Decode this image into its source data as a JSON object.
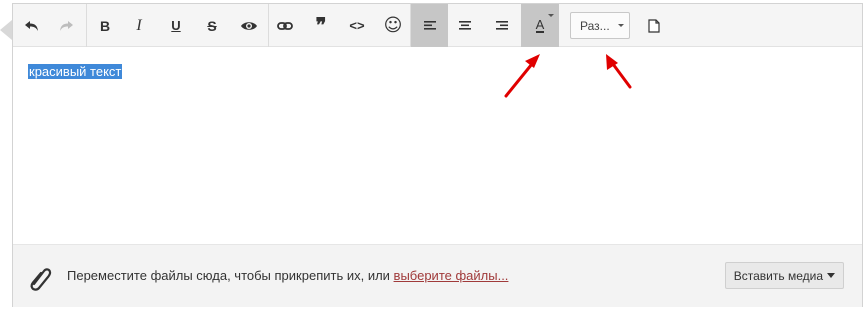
{
  "toolbar": {
    "buttons": [
      {
        "name": "undo-icon",
        "title": "undo"
      },
      {
        "name": "redo-icon",
        "title": "redo"
      },
      {
        "name": "bold-icon",
        "glyph": "B"
      },
      {
        "name": "italic-icon",
        "glyph": "I"
      },
      {
        "name": "underline-icon",
        "glyph": "U"
      },
      {
        "name": "strikethrough-icon",
        "glyph": "S"
      },
      {
        "name": "eye-icon"
      },
      {
        "name": "link-icon"
      },
      {
        "name": "quote-icon",
        "glyph": "❞"
      },
      {
        "name": "code-icon",
        "glyph": "<>"
      },
      {
        "name": "smiley-icon",
        "glyph": "☺"
      },
      {
        "name": "align-left-icon"
      },
      {
        "name": "align-center-icon"
      },
      {
        "name": "align-right-icon"
      },
      {
        "name": "font-color-icon",
        "glyph": "A"
      },
      {
        "name": "new-page-icon"
      }
    ],
    "size_dropdown_label": "Раз..."
  },
  "editor": {
    "selected_text": "красивый текст"
  },
  "footer": {
    "drop_text": "Переместите файлы сюда, чтобы прикрепить их, или ",
    "drop_link": "выберите файлы...",
    "insert_media_label": "Вставить медиа"
  },
  "colors": {
    "selection": "#3f89d9",
    "link": "#a03a3a",
    "arrow": "#e00000"
  }
}
